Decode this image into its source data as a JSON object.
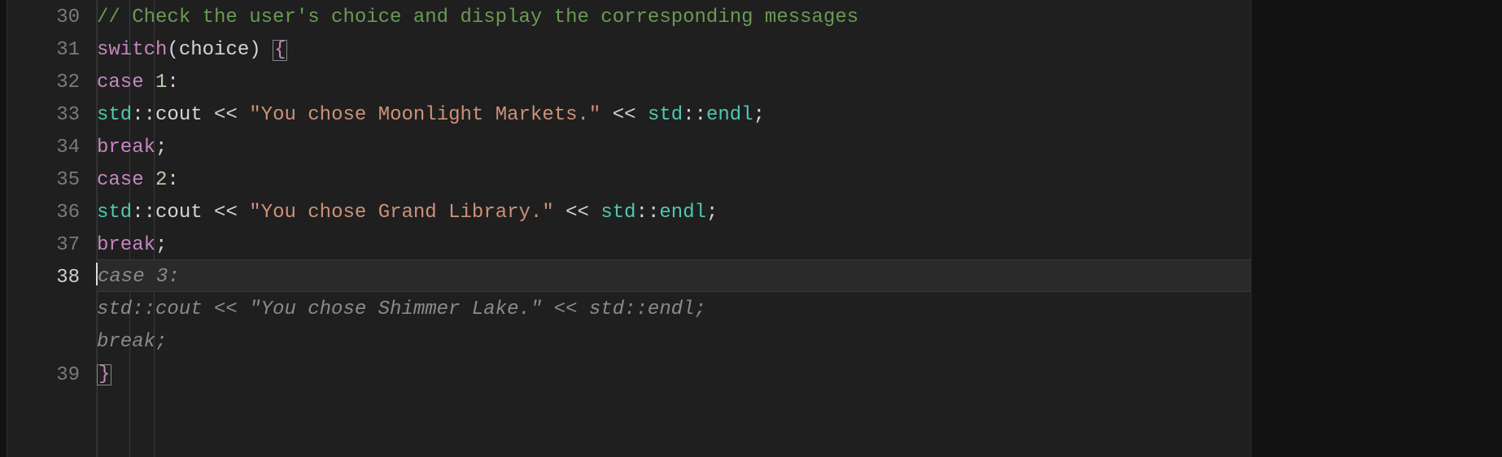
{
  "editor": {
    "gutter": {
      "30": "30",
      "31": "31",
      "32": "32",
      "33": "33",
      "34": "34",
      "35": "35",
      "36": "36",
      "37": "37",
      "38": "38",
      "39": "39"
    },
    "code": {
      "line30_comment": "// Check the user's choice and display the corresponding messages",
      "line31_switch": "switch",
      "line31_open": "(",
      "line31_choice": "choice",
      "line31_close": ") ",
      "line31_brace": "{",
      "line32_case": "case",
      "line32_sp": " ",
      "line32_num": "1",
      "line32_colon": ":",
      "line33_std": "std",
      "line33_ns": "::",
      "line33_cout": "cout ",
      "line33_op1": "<< ",
      "line33_str": "\"You chose Moonlight Markets.\"",
      "line33_sp2": " ",
      "line33_op2": "<< ",
      "line33_std2": "std",
      "line33_ns2": "::",
      "line33_endl": "endl",
      "line33_semi": ";",
      "line34_break": "break",
      "line34_semi": ";",
      "line35_case": "case",
      "line35_sp": " ",
      "line35_num": "2",
      "line35_colon": ":",
      "line36_std": "std",
      "line36_ns": "::",
      "line36_cout": "cout ",
      "line36_op1": "<< ",
      "line36_str": "\"You chose Grand Library.\"",
      "line36_sp2": " ",
      "line36_op2": "<< ",
      "line36_std2": "std",
      "line36_ns2": "::",
      "line36_endl": "endl",
      "line36_semi": ";",
      "line37_break": "break",
      "line37_semi": ";",
      "ghost_line1": "case 3:",
      "ghost_line2": "std::cout << \"You chose Shimmer Lake.\" << std::endl;",
      "ghost_line3": "break;",
      "line39_brace": "}"
    },
    "active_line": "38"
  }
}
